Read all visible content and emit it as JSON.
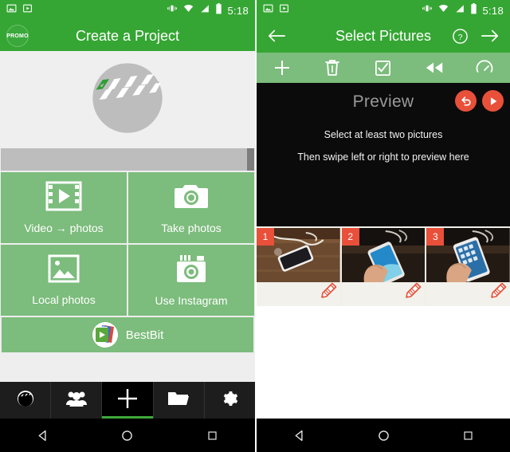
{
  "left": {
    "statusbar": {
      "time": "5:18",
      "icons": [
        "image-icon",
        "video-icon",
        "vibrate-icon",
        "wifi-icon",
        "signal-icon",
        "battery-icon"
      ]
    },
    "appbar": {
      "badge_label": "PROMO",
      "title": "Create a Project"
    },
    "hero": {
      "icon": "clapperboard-icon"
    },
    "tiles": [
      {
        "label": "Video → photos",
        "icon": "film-play-icon"
      },
      {
        "label": "Take photos",
        "icon": "camera-icon"
      },
      {
        "label": "Local photos",
        "icon": "gallery-icon"
      },
      {
        "label": "Use Instagram",
        "icon": "instagram-icon"
      }
    ],
    "bestbit": {
      "label": "BestBit",
      "icon": "bestbit-logo-icon"
    },
    "bottom_nav": [
      {
        "name": "clapper",
        "icon": "clapperboard-icon",
        "active": false
      },
      {
        "name": "people",
        "icon": "people-icon",
        "active": false
      },
      {
        "name": "add",
        "icon": "plus-icon",
        "active": true
      },
      {
        "name": "folder",
        "icon": "folder-icon",
        "active": false
      },
      {
        "name": "settings",
        "icon": "gear-icon",
        "active": false
      }
    ],
    "system_nav": [
      "back-triangle-icon",
      "home-circle-icon",
      "recents-square-icon"
    ]
  },
  "right": {
    "statusbar": {
      "time": "5:18",
      "icons": [
        "image-icon",
        "video-icon",
        "vibrate-icon",
        "wifi-icon",
        "signal-icon",
        "battery-icon"
      ]
    },
    "appbar": {
      "back_icon": "arrow-left-icon",
      "title": "Select Pictures",
      "help_icon": "question-mark-icon",
      "next_icon": "arrow-right-icon"
    },
    "toolbar": [
      {
        "name": "add",
        "icon": "plus-icon"
      },
      {
        "name": "delete",
        "icon": "trash-icon"
      },
      {
        "name": "select-all",
        "icon": "checkbox-icon"
      },
      {
        "name": "rewind",
        "icon": "rewind-icon"
      },
      {
        "name": "speed",
        "icon": "speedometer-icon"
      }
    ],
    "preview": {
      "title": "Preview",
      "line1": "Select at least two pictures",
      "line2": "Then swipe left or right to preview here",
      "undo_icon": "undo-icon",
      "play_icon": "play-icon"
    },
    "thumbnails": [
      {
        "badge": "1",
        "edit_icon": "pencil-icon"
      },
      {
        "badge": "2",
        "edit_icon": "pencil-icon"
      },
      {
        "badge": "3",
        "edit_icon": "pencil-icon"
      }
    ],
    "system_nav": [
      "back-triangle-icon",
      "home-circle-icon",
      "recents-square-icon"
    ]
  },
  "colors": {
    "header_green": "#35a633",
    "tile_green": "#7cbc7c",
    "accent_orange": "#e8503a",
    "gray_bar": "#bdbdbd",
    "nav_black": "#1d1d1d"
  }
}
